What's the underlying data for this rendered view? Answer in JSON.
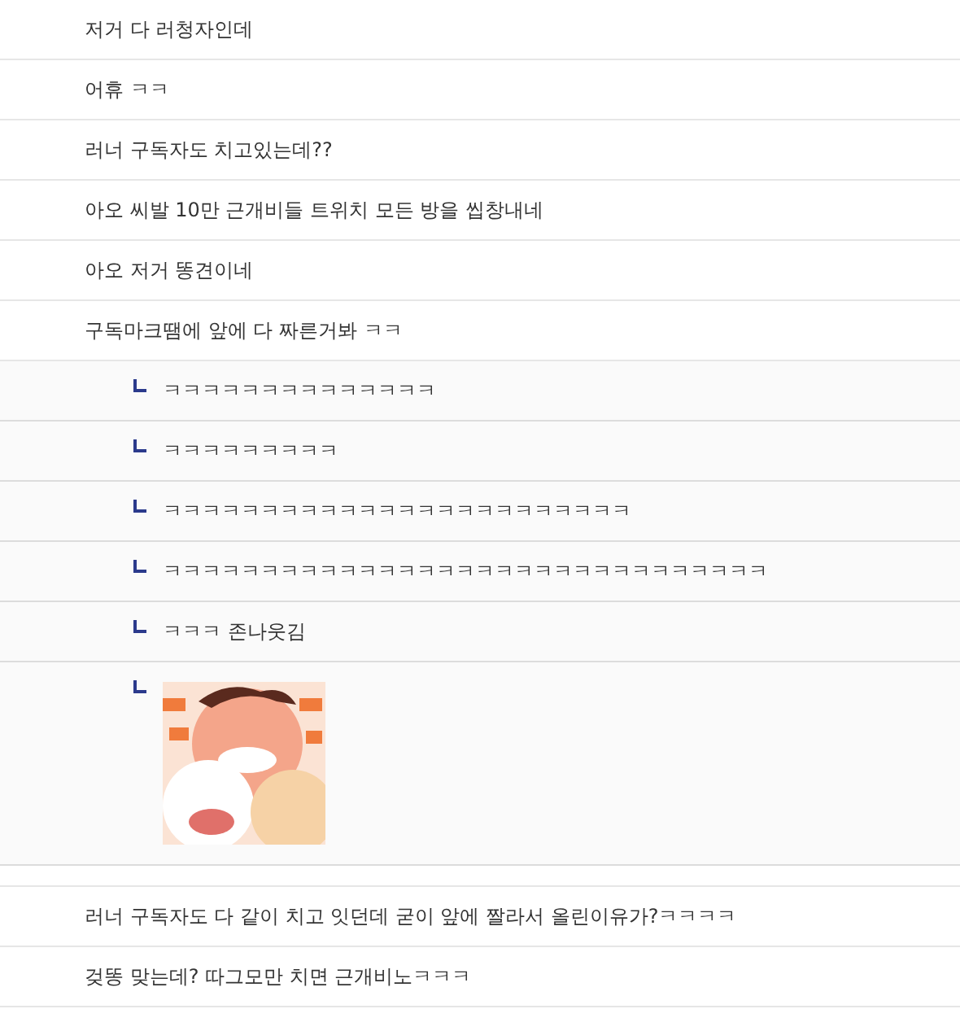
{
  "comments": [
    {
      "text": "저거 다 러청자인데"
    },
    {
      "text": "어휴 ㅋㅋ"
    },
    {
      "text": "러너 구독자도 치고있는데??"
    },
    {
      "text": "아오 씨발 10만 근개비들 트위치 모든 방을 씹창내네"
    },
    {
      "text": "아오 저거 똥견이네"
    },
    {
      "text": "구독마크땜에 앞에 다 짜른거봐 ㅋㅋ",
      "replies": [
        {
          "kind": "text",
          "text": "ㅋㅋㅋㅋㅋㅋㅋㅋㅋㅋㅋㅋㅋㅋ"
        },
        {
          "kind": "text",
          "text": "ㅋㅋㅋㅋㅋㅋㅋㅋㅋ"
        },
        {
          "kind": "text",
          "text": "ㅋㅋㅋㅋㅋㅋㅋㅋㅋㅋㅋㅋㅋㅋㅋㅋㅋㅋㅋㅋㅋㅋㅋㅋ"
        },
        {
          "kind": "text",
          "text": "ㅋㅋㅋㅋㅋㅋㅋㅋㅋㅋㅋㅋㅋㅋㅋㅋㅋㅋㅋㅋㅋㅋㅋㅋㅋㅋㅋㅋㅋㅋㅋ"
        },
        {
          "kind": "text",
          "text": "ㅋㅋㅋ 존나웃김"
        },
        {
          "kind": "picture"
        }
      ]
    },
    {
      "text": "러너 구독자도 다 같이 치고 잇던데 굳이 앞에 짤라서 올린이유가?ㅋㅋㅋㅋ"
    },
    {
      "text": "겆똥 맞는데? 따그모만 치면 근개비노ㅋㅋㅋ"
    }
  ]
}
